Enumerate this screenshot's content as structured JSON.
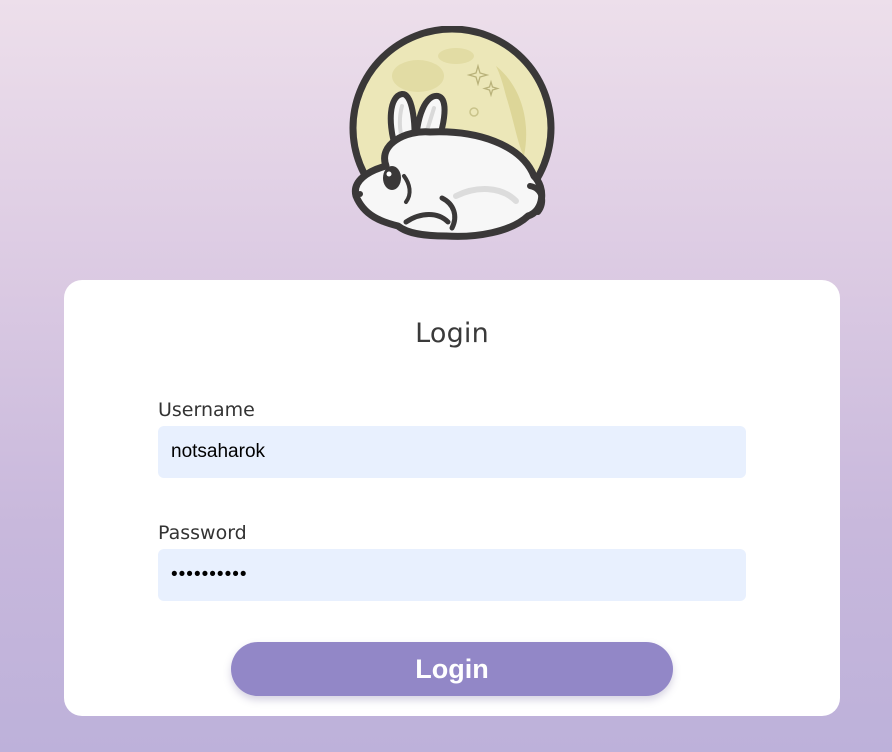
{
  "logo": {
    "icon": "moon-rabbit-logo",
    "moon_color": "#ece7b8",
    "rabbit_color": "#f7f7f7",
    "outline_color": "#3a3838"
  },
  "login_form": {
    "title": "Login",
    "username": {
      "label": "Username",
      "value": "notsaharok"
    },
    "password": {
      "label": "Password",
      "value": "••••••••••"
    },
    "submit_label": "Login"
  },
  "colors": {
    "background_top": "#eddfeb",
    "background_bottom": "#bdb1da",
    "card": "#ffffff",
    "input_fill": "#e8f0fe",
    "button": "#9287c7"
  }
}
